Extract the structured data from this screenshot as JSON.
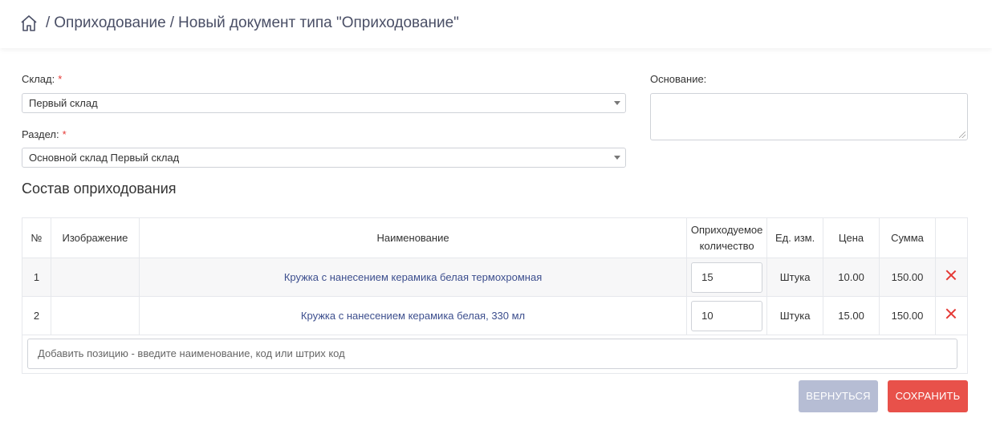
{
  "breadcrumb": {
    "home_icon": "home-icon",
    "sep1": "/",
    "section": "Оприходование",
    "sep2": "/",
    "current": "Новый документ типа \"Оприходование\""
  },
  "form": {
    "warehouse_label": "Склад:",
    "warehouse_value": "Первый склад",
    "section_label": "Раздел:",
    "section_value": "Основной склад Первый склад",
    "required_mark": "*",
    "basis_label": "Основание:",
    "basis_value": ""
  },
  "composition": {
    "title": "Состав оприходования",
    "columns": {
      "num": "№",
      "image": "Изображение",
      "name": "Наименование",
      "qty_line1": "Оприходуемое",
      "qty_line2": "количество",
      "unit": "Ед. изм.",
      "price": "Цена",
      "sum": "Сумма"
    },
    "rows": [
      {
        "num": "1",
        "name": "Кружка с нанесением керамика белая термохромная",
        "qty": "15",
        "unit": "Штука",
        "price": "10.00",
        "sum": "150.00"
      },
      {
        "num": "2",
        "name": "Кружка с нанесением керамика белая, 330 мл",
        "qty": "10",
        "unit": "Штука",
        "price": "15.00",
        "sum": "150.00"
      }
    ],
    "add_placeholder": "Добавить позицию - введите наименование, код или штрих код"
  },
  "buttons": {
    "back": "ВЕРНУТЬСЯ",
    "save": "СОХРАНИТЬ"
  },
  "colors": {
    "danger": "#e53935",
    "link": "#3d4f8e",
    "back_button": "#b6bdd4",
    "save_button": "#e8514a"
  }
}
